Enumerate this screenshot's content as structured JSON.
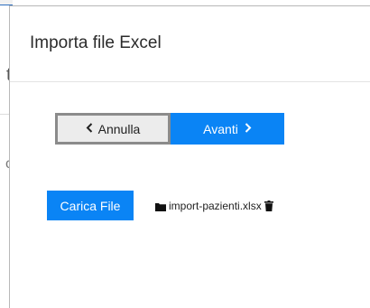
{
  "background": {
    "fragments": [
      "t",
      "c"
    ]
  },
  "modal": {
    "title": "Importa file Excel"
  },
  "navigation": {
    "back_label": "Annulla",
    "next_label": "Avanti",
    "back_icon": "chevron-left-icon",
    "next_icon": "chevron-right-icon"
  },
  "upload": {
    "button_label": "Carica File",
    "file_name": "import-pazienti.xlsx",
    "folder_icon": "folder-icon",
    "delete_icon": "trash-icon"
  },
  "colors": {
    "accent": "#0a84f5",
    "back_button_bg": "#ececec",
    "back_button_border": "#8b8b8b"
  }
}
